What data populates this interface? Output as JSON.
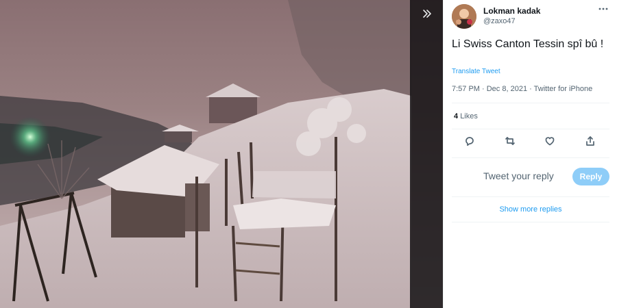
{
  "tweet": {
    "author_name": "Lokman kadak",
    "author_handle": "@zaxo47",
    "text": "Li Swiss Canton Tessin spî bû !",
    "translate_label": "Translate Tweet",
    "timestamp": "7:57 PM · Dec 8, 2021 · Twitter for iPhone",
    "likes_count": "4",
    "likes_label": "Likes"
  },
  "reply": {
    "placeholder": "Tweet your reply",
    "button_label": "Reply"
  },
  "show_more_label": "Show more replies",
  "icons": {
    "collapse": "double-chevron-right-icon",
    "more": "more-horizontal-icon",
    "reply": "comment-icon",
    "retweet": "retweet-icon",
    "like": "heart-icon",
    "share": "share-icon"
  },
  "colors": {
    "accent": "#1d9bf0",
    "reply_button_disabled": "#8ecdf8",
    "secondary_text": "#536471",
    "primary_text": "#0f1419"
  }
}
